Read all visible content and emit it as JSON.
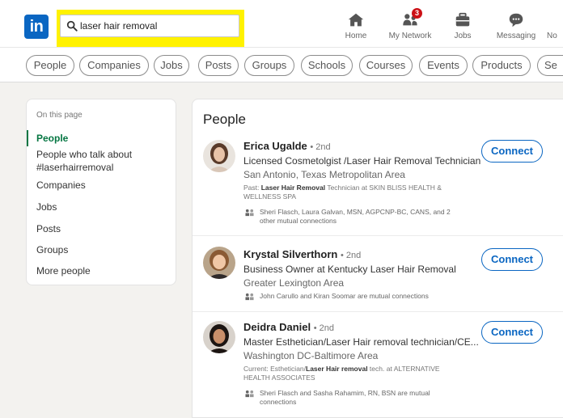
{
  "nav": {
    "logo_text": "in",
    "search_value": "laser hair removal",
    "items": [
      {
        "label": "Home",
        "icon": "home-icon"
      },
      {
        "label": "My Network",
        "icon": "network-icon",
        "badge": "3"
      },
      {
        "label": "Jobs",
        "icon": "briefcase-icon"
      },
      {
        "label": "Messaging",
        "icon": "messaging-icon"
      },
      {
        "label": "No",
        "icon": "notifications-icon"
      }
    ]
  },
  "filters": [
    "People",
    "Companies",
    "Jobs",
    "Posts",
    "Groups",
    "Schools",
    "Courses",
    "Events",
    "Products",
    "Se"
  ],
  "sidebar": {
    "heading": "On this page",
    "items": [
      "People",
      "People who talk about #laserhairremoval",
      "Companies",
      "Jobs",
      "Posts",
      "Groups",
      "More people"
    ]
  },
  "results": {
    "title": "People",
    "connect_label": "Connect",
    "people": [
      {
        "name": "Erica Ugalde",
        "degree": "• 2nd",
        "headline": "Licensed Cosmetolgist /Laser Hair Removal Technician",
        "location": "San Antonio, Texas Metropolitan Area",
        "snippet_prefix": "Past: ",
        "snippet_bold": "Laser Hair Removal",
        "snippet_suffix": " Technician at SKIN BLISS HEALTH & WELLNESS SPA",
        "mutual": "Sheri Flasch, Laura Galvan, MSN, AGPCNP-BC, CANS, and 2 other mutual connections"
      },
      {
        "name": "Krystal Silverthorn",
        "degree": "• 2nd",
        "headline": "Business Owner at Kentucky Laser Hair Removal",
        "location": "Greater Lexington Area",
        "mutual": "John Carullo and Kiran Soomar are mutual connections"
      },
      {
        "name": "Deidra Daniel",
        "degree": "• 2nd",
        "headline": "Master Esthetician/Laser Hair removal technician/CE...",
        "location": "Washington DC-Baltimore Area",
        "snippet_prefix": "Current: Esthetician/",
        "snippet_bold": "Laser Hair removal",
        "snippet_suffix": " tech. at ALTERNATIVE HEALTH ASSOCIATES",
        "mutual": "Sheri Flasch and Sasha Rahamim, RN, BSN are mutual connections"
      }
    ]
  },
  "colors": {
    "brand_blue": "#0a66c2",
    "highlight_yellow": "#fff200",
    "active_green": "#057642",
    "badge_red": "#cc1016"
  }
}
